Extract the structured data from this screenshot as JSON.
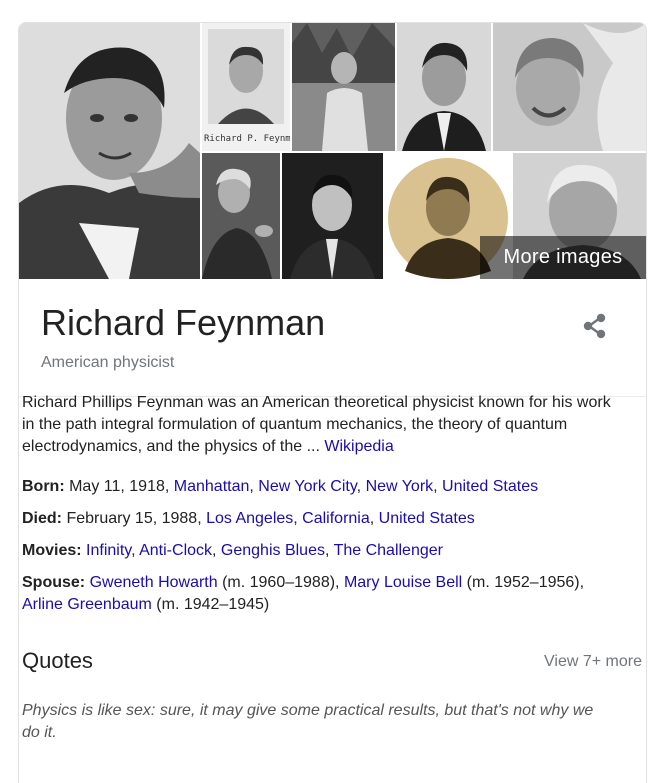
{
  "gallery": {
    "caption": "Richard P. Feynm",
    "more_images": "More images"
  },
  "entity": {
    "title": "Richard Feynman",
    "subtitle": "American physicist",
    "share_icon": "share-icon"
  },
  "description": {
    "text": "Richard Phillips Feynman was an American theoretical physicist known for his work in the path integral formulation of quantum mechanics, the theory of quantum electrodynamics, and the physics of the ... ",
    "source": "Wikipedia"
  },
  "facts": {
    "born": {
      "label": "Born:",
      "text": " May 11, 1918, ",
      "links": [
        "Manhattan",
        "New York City",
        "New York",
        "United States"
      ]
    },
    "died": {
      "label": "Died:",
      "text": " February 15, 1988, ",
      "links": [
        "Los Angeles",
        "California",
        "United States"
      ]
    },
    "movies": {
      "label": "Movies:",
      "links": [
        "Infinity",
        "Anti-Clock",
        "Genghis Blues",
        "The Challenger"
      ]
    },
    "spouse": {
      "label": "Spouse:",
      "s1": "Gweneth Howarth",
      "s1_years": " (m. 1960–1988), ",
      "s2": "Mary Louise Bell",
      "s2_years": " (m. 1952–1956), ",
      "s3": "Arline Greenbaum",
      "s3_years": " (m. 1942–1945)"
    }
  },
  "quotes": {
    "heading": "Quotes",
    "view_more": "View 7+ more",
    "first": "Physics is like sex: sure, it may give some practical results, but that's not why we do it."
  }
}
